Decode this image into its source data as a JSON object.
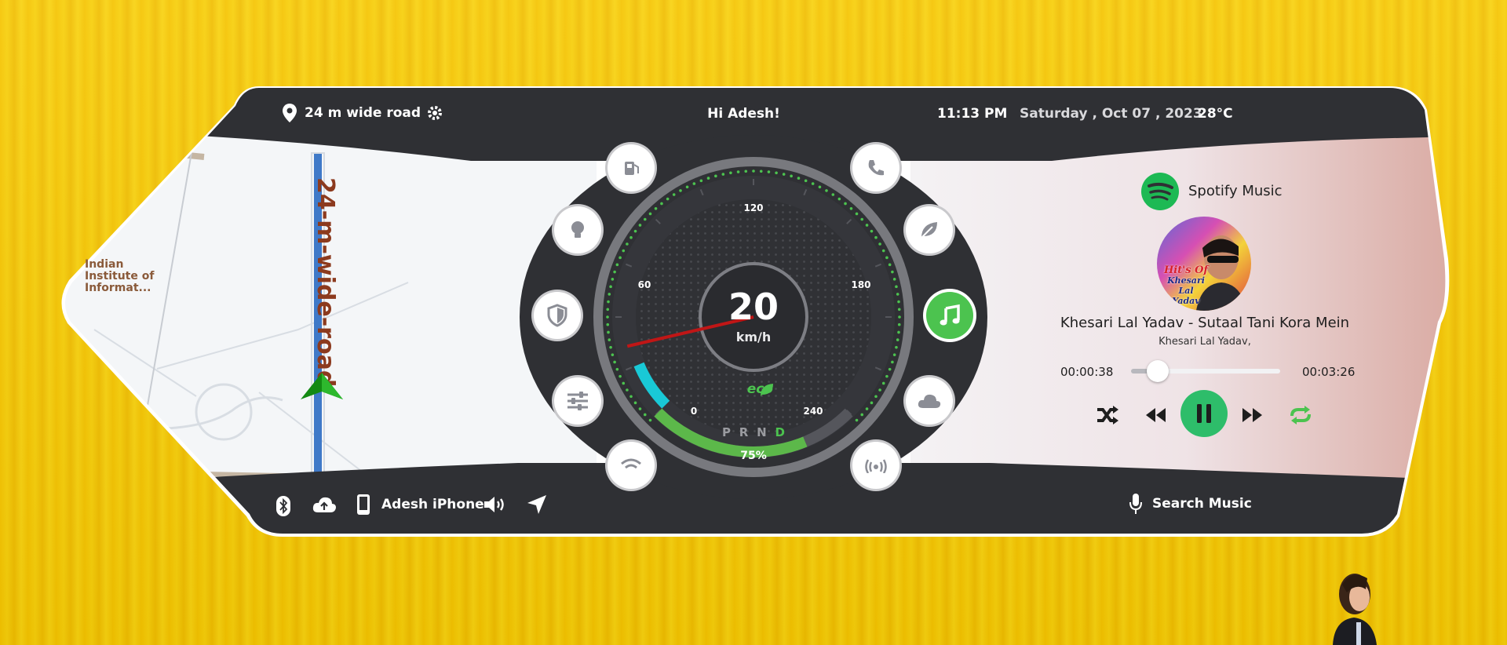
{
  "status_bar": {
    "location": "24 m wide road",
    "greeting": "Hi Adesh!",
    "time": "11:13 PM",
    "date": "Saturday , Oct 07 , 2023",
    "temperature": "28°C"
  },
  "map": {
    "road_label": "24-m-wide-road",
    "poi_label_1": "Indian",
    "poi_label_2": "Institute of",
    "poi_label_3": "Informat..."
  },
  "speedometer": {
    "speed": "20",
    "unit": "km/h",
    "mode": "eco",
    "ticks": [
      "0",
      "60",
      "120",
      "180",
      "240"
    ],
    "gears": [
      "P",
      "R",
      "N",
      "D"
    ],
    "active_gear": "D",
    "battery": "75%",
    "battery_fraction": 0.75,
    "speed_value": 20,
    "max_speed": 240
  },
  "side_buttons": {
    "left": [
      "fuel-icon",
      "bulb-icon",
      "shield-icon",
      "sliders-icon",
      "wifi-icon"
    ],
    "right": [
      "phone-icon",
      "leaf-icon",
      "music-icon",
      "cloud-icon",
      "signal-icon"
    ],
    "active": "music-icon"
  },
  "music": {
    "app_name": "Spotify Music",
    "album_text_1": "Hit's Of",
    "album_text_2": "Khesari Lal",
    "album_text_3": "Yadav",
    "track_title": "Khesari Lal Yadav - Sutaal Tani Kora Mein",
    "artist": "Khesari Lal Yadav,",
    "elapsed": "00:00:38",
    "duration": "00:03:26",
    "progress_fraction": 0.18
  },
  "bottom_bar": {
    "device_name": "Adesh iPhone",
    "search_label": "Search Music"
  },
  "colors": {
    "panel": "#2f3034",
    "accent_green": "#4cc34f",
    "spotify": "#1db954",
    "gauge_cyan": "#19c9d6",
    "needle": "#c01616"
  }
}
